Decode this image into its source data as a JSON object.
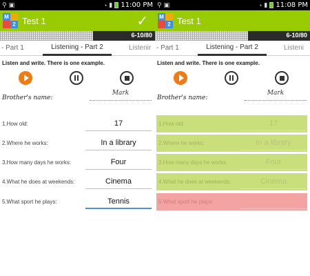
{
  "screens": [
    {
      "status_time": "11:00 PM",
      "app_title": "Test 1",
      "progress_text": "6-10/80",
      "tabs": {
        "prev": "- Part 1",
        "active": "Listening - Part 2",
        "next": "Listenir"
      },
      "instruction": "Listen and write. There is one example.",
      "example": {
        "label": "Brother's name:",
        "answer": "Mark"
      },
      "questions": [
        {
          "label": "1.How old:",
          "answer": "17"
        },
        {
          "label": "2.Where he works:",
          "answer": "In a library"
        },
        {
          "label": "3.How many days he works:",
          "answer": "Four"
        },
        {
          "label": "4.What he does at weekends:",
          "answer": "Cinema"
        },
        {
          "label": "5.What sport he plays:",
          "answer": "Tennis"
        }
      ]
    },
    {
      "status_time": "11:08 PM",
      "app_title": "Test 1",
      "progress_text": "6-10/80",
      "tabs": {
        "prev": "- Part 1",
        "active": "Listening - Part 2",
        "next": "Listeni"
      },
      "instruction": "Listen and write. There is one example.",
      "example": {
        "label": "Brother's name:",
        "answer": "Mark"
      },
      "questions": [
        {
          "label": "1.How old:",
          "answer": "17"
        },
        {
          "label": "2.Where he works:",
          "answer": "In a library"
        },
        {
          "label": "3.How many days he works:",
          "answer": "Four"
        },
        {
          "label": "4.What he does at weekends:",
          "answer": "Cinema"
        },
        {
          "label": "5.What sport he plays:",
          "answer": ""
        }
      ]
    }
  ],
  "logo_letters": [
    "M",
    "",
    "",
    "2"
  ],
  "progress": {
    "fraction": 0.6
  },
  "colors": {
    "appbar": "#99cc00",
    "play_button": "#f07a13",
    "correct": "#c9df7b",
    "wrong": "#f4a3a3",
    "input_focus": "#4a90d9"
  },
  "icons": [
    "gallery-icon",
    "wifi-icon",
    "signal-icon",
    "battery-icon",
    "check-icon",
    "play-icon",
    "pause-icon",
    "stop-icon"
  ]
}
